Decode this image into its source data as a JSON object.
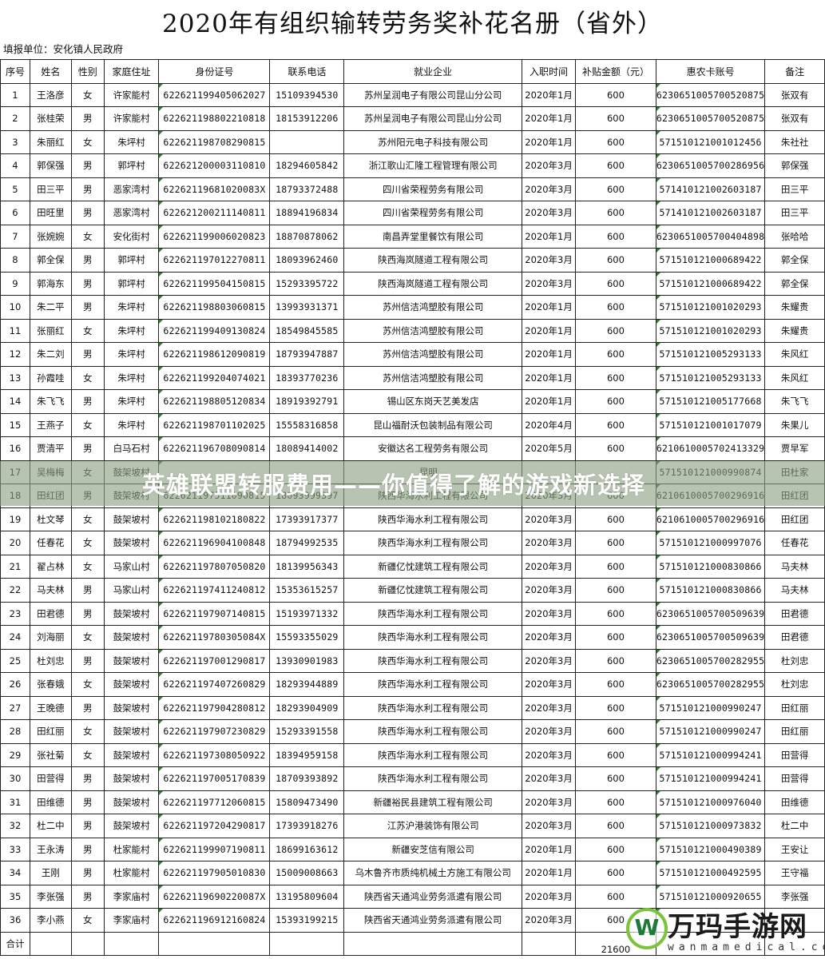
{
  "document": {
    "title": "2020年有组织输转劳务奖补花名册（省外）",
    "reporting_unit": "填报单位：安化镇人民政府"
  },
  "table": {
    "headers": [
      "序号",
      "姓名",
      "性别",
      "家庭住址",
      "身份证号",
      "联系电话",
      "就业企业",
      "入职时间",
      "补贴金额（元）",
      "惠农卡账号",
      "备注"
    ],
    "rows": [
      [
        "1",
        "王洛彦",
        "女",
        "许家能村",
        "622621199405062027",
        "15109394530",
        "苏州呈润电子有限公司昆山分公司",
        "2020年1月",
        "600",
        "623065100570052087​5",
        "张双有"
      ],
      [
        "2",
        "张桂荣",
        "男",
        "许家能村",
        "622621198802210818",
        "18153912206",
        "苏州呈润电子有限公司昆山分公司",
        "2020年1月",
        "600",
        "6230651005700520875",
        "张双有"
      ],
      [
        "3",
        "朱丽红",
        "女",
        "朱坪村",
        "622621198708290815",
        "",
        "苏州阳元电子科技有限公司",
        "2020年1月",
        "600",
        "571510121001012456",
        "朱社社"
      ],
      [
        "4",
        "郭保强",
        "男",
        "郭坪村",
        "622621200003110810",
        "18294605842",
        "浙江歌山汇隆工程管理有限公司",
        "2020年3月",
        "600",
        "6230651005700286956",
        "郭保强"
      ],
      [
        "5",
        "田三平",
        "男",
        "恶家湾村",
        "62262119681020083X",
        "18793372488",
        "四川省荣程劳务有限公司",
        "2020年3月",
        "600",
        "571410121002603187",
        "田三平"
      ],
      [
        "6",
        "田旺里",
        "男",
        "恶家湾村",
        "622621200211140811",
        "18894196834",
        "四川省荣程劳务有限公司",
        "2020年3月",
        "600",
        "571410121002603187",
        "田三平"
      ],
      [
        "7",
        "张婉婉",
        "女",
        "安化街村",
        "622621199006020823",
        "18870878062",
        "南昌弄堂里餐饮有限公司",
        "2020年1月",
        "600",
        "6230651005700404898",
        "张哈哈"
      ],
      [
        "8",
        "郭全保",
        "男",
        "郭坪村",
        "622621197012270811",
        "18093962460",
        "陕西海岚隧道工程有限公司",
        "2020年3月",
        "600",
        "571510121000689422",
        "郭全保"
      ],
      [
        "9",
        "郭海东",
        "男",
        "郭坪村",
        "622621199504150815",
        "15293395722",
        "陕西海岚隧道工程有限公司",
        "2020年3月",
        "600",
        "571510121000689422",
        "郭全保"
      ],
      [
        "10",
        "朱二平",
        "男",
        "朱坪村",
        "622621198803060815",
        "13993931371",
        "苏州信洁鸿塑胶有限公司",
        "2020年1月",
        "600",
        "571510121001020293",
        "朱耀贵"
      ],
      [
        "11",
        "张丽红",
        "女",
        "朱坪村",
        "622621199409130824",
        "18549845585",
        "苏州信洁鸿塑胶有限公司",
        "2020年1月",
        "600",
        "571510121001020293",
        "朱耀贵"
      ],
      [
        "12",
        "朱二刘",
        "男",
        "朱坪村",
        "622621198612090819",
        "18793947887",
        "苏州信洁鸿塑胶有限公司",
        "2020年1月",
        "600",
        "571510121005293133",
        "朱风红"
      ],
      [
        "13",
        "孙霞哇",
        "女",
        "朱坪村",
        "622621199204074021",
        "18393770236",
        "苏州信洁鸿塑胶有限公司",
        "2020年1月",
        "600",
        "571510121005293133",
        "朱风红"
      ],
      [
        "14",
        "朱飞飞",
        "男",
        "朱坪村",
        "622621198805120834",
        "18919392791",
        "锡山区东岗天艺美发店",
        "2020年1月",
        "600",
        "571510121005177668",
        "朱飞飞"
      ],
      [
        "15",
        "王燕子",
        "女",
        "朱坪村",
        "622621198701102025",
        "15558316858",
        "昆山福耐沃包装制品有限公司",
        "2020年4月",
        "600",
        "571510121001017079",
        "朱果儿"
      ],
      [
        "16",
        "贾清平",
        "男",
        "白马石村",
        "622621196708090814",
        "18089414002",
        "安徽达名工程劳务有限公司",
        "2020年5月",
        "600",
        "6210610005702413329",
        "贾早军"
      ],
      [
        "17",
        "吴梅梅",
        "女",
        "鼓架坡村",
        "",
        "",
        "昆明…",
        "",
        "",
        "571510121000990874",
        "田杜家"
      ],
      [
        "18",
        "田红团",
        "男",
        "鼓架坡村",
        "622621197511090815",
        "18093999397",
        "陕西华海水利工程有限公司",
        "2020年3月",
        "600",
        "6210610005700296916",
        "田红团"
      ],
      [
        "19",
        "杜文琴",
        "女",
        "鼓架坡村",
        "622621198102180822",
        "17393917377",
        "陕西华海水利工程有限公司",
        "2020年3月",
        "600",
        "6210610005700296916",
        "田红团"
      ],
      [
        "20",
        "任春花",
        "女",
        "鼓架坡村",
        "622621196904100848",
        "18794992535",
        "陕西华海水利工程有限公司",
        "2020年3月",
        "600",
        "571510121000997076",
        "任春花"
      ],
      [
        "21",
        "翟占林",
        "女",
        "马家山村",
        "622621197807050820",
        "18139956343",
        "新疆亿忱建筑工程有限公司",
        "2020年3月",
        "600",
        "571510121000830866",
        "马夫林"
      ],
      [
        "22",
        "马夫林",
        "男",
        "马家山村",
        "622621197411240812",
        "15353615257",
        "新疆亿忱建筑工程有限公司",
        "2020年3月",
        "600",
        "571510121000830866",
        "马夫林"
      ],
      [
        "23",
        "田君德",
        "男",
        "鼓架坡村",
        "622621197907140815",
        "15193971332",
        "陕西华海水利工程有限公司",
        "2020年3月",
        "600",
        "6230651005700509639",
        "田君德"
      ],
      [
        "24",
        "刘海丽",
        "女",
        "鼓架坡村",
        "62262119780305084X",
        "15593355029",
        "陕西华海水利工程有限公司",
        "2020年3月",
        "600",
        "6230651005700509639",
        "田君德"
      ],
      [
        "25",
        "杜刘忠",
        "男",
        "鼓架坡村",
        "622621197001290817",
        "13930901983",
        "陕西华海水利工程有限公司",
        "2020年3月",
        "600",
        "6230651005700282955",
        "杜刘忠"
      ],
      [
        "26",
        "张春娥",
        "女",
        "鼓架坡村",
        "622621197407260829",
        "18293944889",
        "陕西华海水利工程有限公司",
        "2020年3月",
        "600",
        "6230651005700282955",
        "杜刘忠"
      ],
      [
        "27",
        "王晚德",
        "男",
        "鼓架坡村",
        "622621197904280812",
        "18293904909",
        "陕西华海水利工程有限公司",
        "2020年3月",
        "600",
        "571510121000990247",
        "田红丽"
      ],
      [
        "28",
        "田红丽",
        "女",
        "鼓架坡村",
        "622621197907230829",
        "15293391558",
        "陕西华海水利工程有限公司",
        "2020年3月",
        "600",
        "571510121000990247",
        "田红丽"
      ],
      [
        "29",
        "张社菊",
        "女",
        "鼓架坡村",
        "622621197308050922",
        "18394959158",
        "陕西华海水利工程有限公司",
        "2020年3月",
        "600",
        "571510121000994241",
        "田营得"
      ],
      [
        "30",
        "田营得",
        "男",
        "鼓架坡村",
        "622621197005170839",
        "18709393892",
        "陕西华海水利工程有限公司",
        "2020年3月",
        "600",
        "571510121000994241",
        "田营得"
      ],
      [
        "31",
        "田维德",
        "男",
        "鼓架坡村",
        "622621197712060815",
        "15809473490",
        "新疆裕民县建筑工程有限公司",
        "2020年3月",
        "600",
        "571510121000976040",
        "田维德"
      ],
      [
        "32",
        "杜二中",
        "男",
        "鼓架坡村",
        "622621197204290817",
        "17393918276",
        "江苏沪港装饰有限公司",
        "2020年3月",
        "600",
        "571510121000973832",
        "杜二中"
      ],
      [
        "33",
        "王永涛",
        "男",
        "杜家能村",
        "622621199907190811",
        "18699163612",
        "新疆安芝信有限公司",
        "2020年1月",
        "600",
        "571510121000490389",
        "王安让"
      ],
      [
        "34",
        "王刚",
        "男",
        "杜家能村",
        "622621197905010830",
        "15009008663",
        "乌木鲁齐市质纯机械土方施工有限公司",
        "2020年1月",
        "600",
        "571510121000492595",
        "王守福"
      ],
      [
        "35",
        "李张强",
        "男",
        "李家庙村",
        "62262119690220087X",
        "13195809604",
        "陕西省天通鸿业劳务派遣有限公司",
        "2020年3月",
        "600",
        "571510121000920655",
        "李张强"
      ],
      [
        "36",
        "李小燕",
        "女",
        "李家庙村",
        "622621196912160824",
        "15393199215",
        "陕西省天通鸿业劳务派遣有限公司",
        "2020年3月",
        "600",
        "",
        ""
      ]
    ],
    "total_label": "合计",
    "total_amount": "21600"
  },
  "overlay": {
    "banner_text": "英雄联盟转服费用——你值得了解的游戏新选择",
    "banner_color": "#8ca082"
  },
  "watermark": {
    "logo_glyph": "W",
    "name": "万玛手游网",
    "url": "wanmamedical.com",
    "logo_color": "#7cc23a"
  }
}
